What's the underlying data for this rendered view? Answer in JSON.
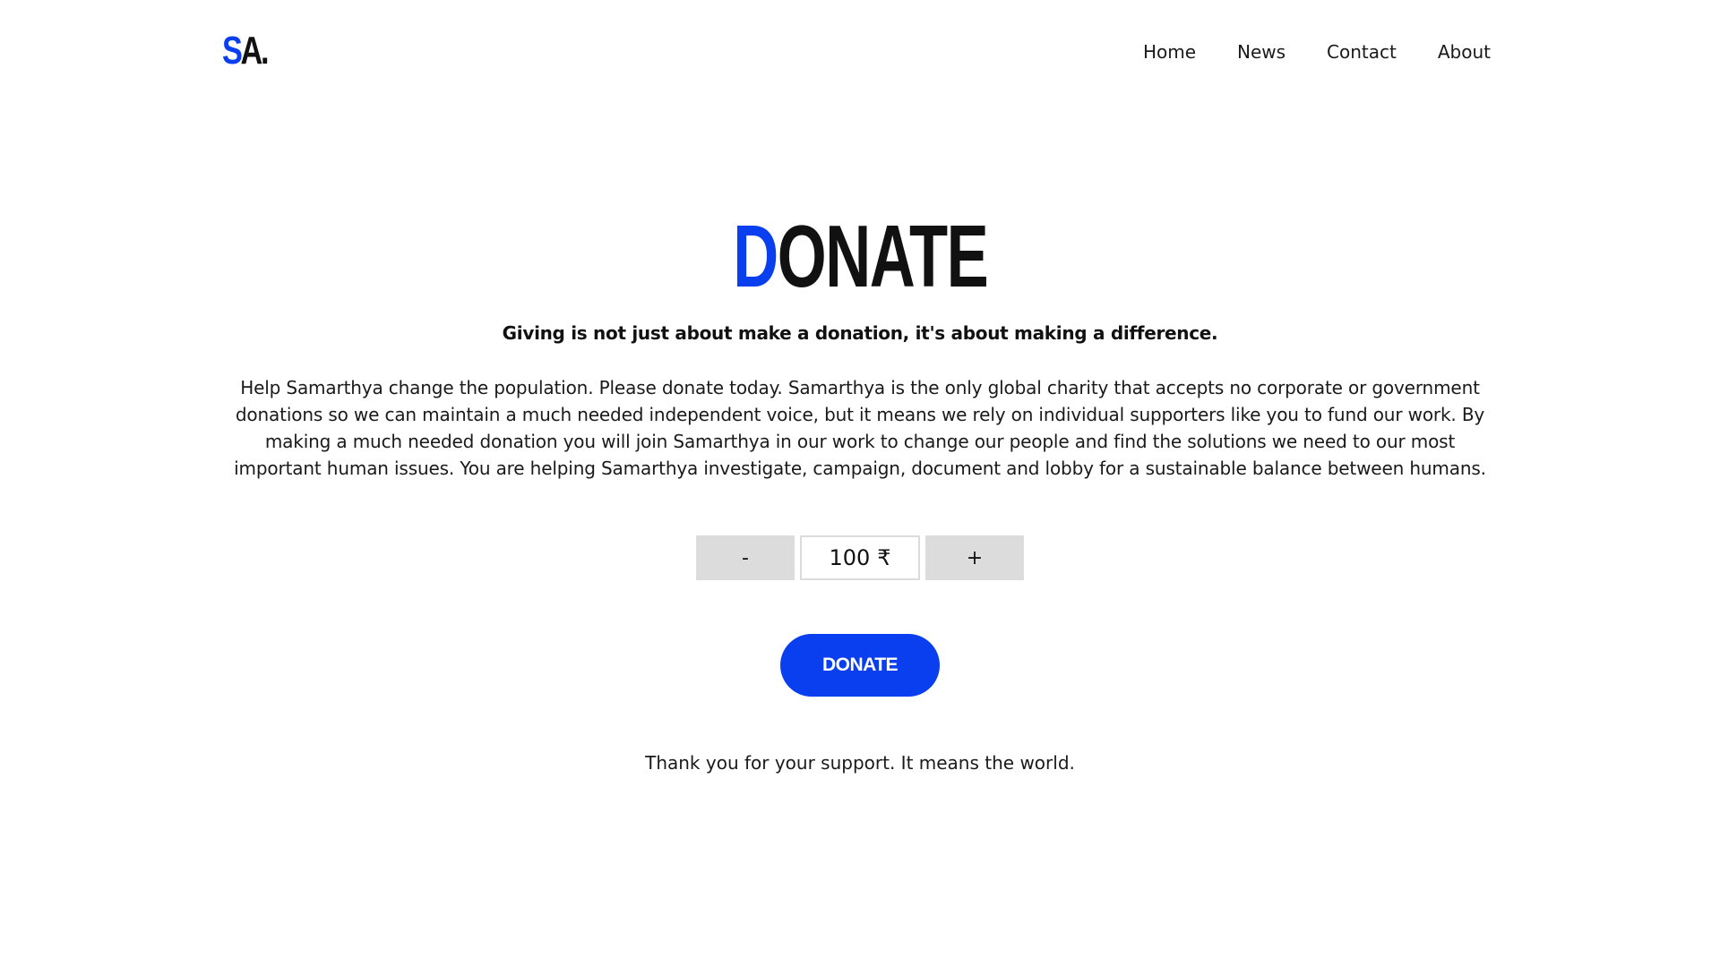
{
  "header": {
    "logo": {
      "accent": "S",
      "rest": "A."
    },
    "nav": [
      "Home",
      "News",
      "Contact",
      "About"
    ]
  },
  "hero": {
    "title_accent": "D",
    "title_rest": "ONATE",
    "subtitle": "Giving is not just about make a donation, it's about making a difference.",
    "body": "Help Samarthya change the population. Please donate today. Samarthya is the only global charity that accepts no corporate or government donations so we can maintain a much needed independent voice, but it means we rely on individual supporters like you to fund our work. By making a much needed donation you will join Samarthya in our work to change our people and find the solutions we need to our most important human issues. You are helping Samarthya investigate, campaign, document and lobby for a sustainable balance between humans."
  },
  "stepper": {
    "minus_label": "-",
    "amount": "100",
    "currency": "₹",
    "plus_label": "+"
  },
  "donate_button": {
    "label": "DONATE"
  },
  "footer_note": "Thank you for your support. It means the world.",
  "colors": {
    "accent": "#0a3ff0",
    "text": "#111111",
    "stepper_bg": "#dcdcdc",
    "background": "#ffffff"
  }
}
